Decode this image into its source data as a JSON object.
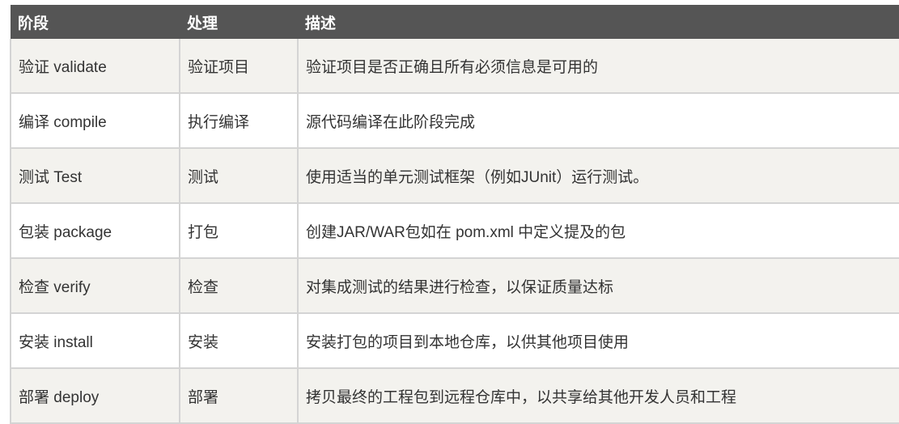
{
  "headers": [
    "阶段",
    "处理",
    "描述"
  ],
  "rows": [
    [
      "验证 validate",
      "验证项目",
      "验证项目是否正确且所有必须信息是可用的"
    ],
    [
      "编译 compile",
      "执行编译",
      "源代码编译在此阶段完成"
    ],
    [
      "测试 Test",
      "测试",
      "使用适当的单元测试框架（例如JUnit）运行测试。"
    ],
    [
      "包装 package",
      "打包",
      "创建JAR/WAR包如在 pom.xml 中定义提及的包"
    ],
    [
      "检查 verify",
      "检查",
      "对集成测试的结果进行检查，以保证质量达标"
    ],
    [
      "安装 install",
      "安装",
      "安装打包的项目到本地仓库，以供其他项目使用"
    ],
    [
      "部署 deploy",
      "部署",
      "拷贝最终的工程包到远程仓库中，以共享给其他开发人员和工程"
    ]
  ]
}
